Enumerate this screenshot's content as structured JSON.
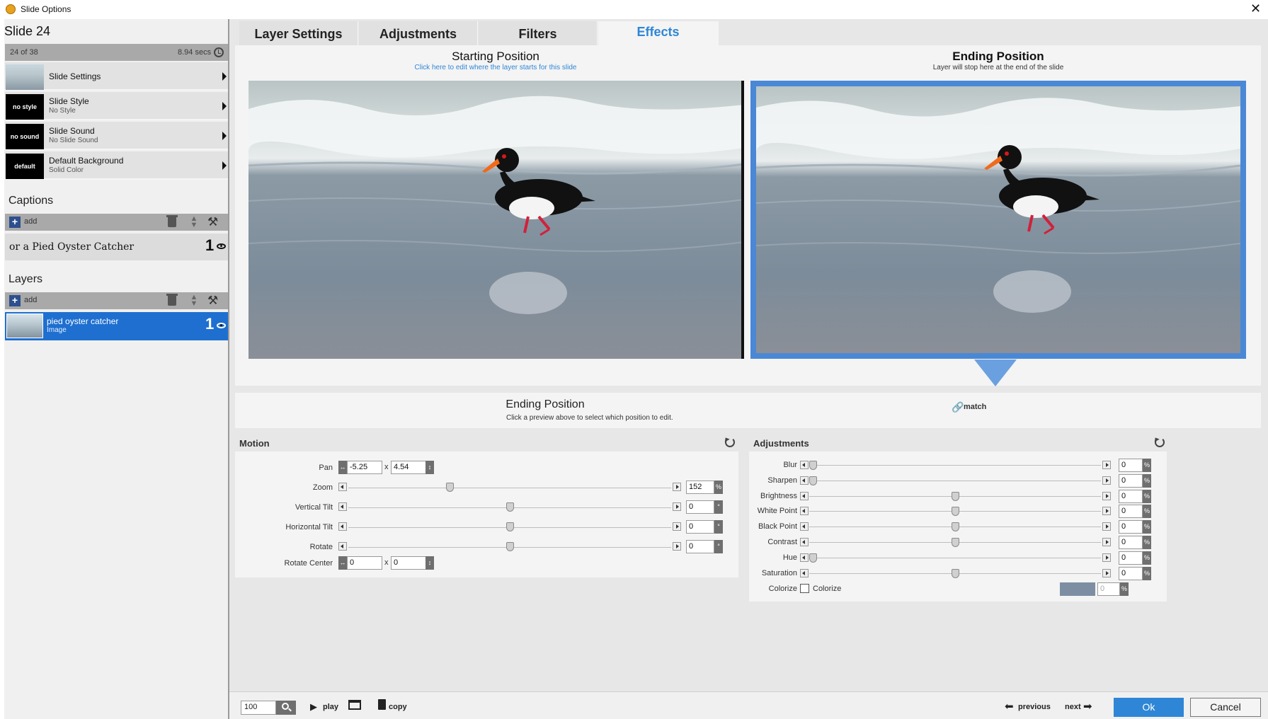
{
  "window": {
    "title": "Slide Options"
  },
  "slide": {
    "title": "Slide 24",
    "count": "24 of 38",
    "duration": "8.94 secs",
    "menu": [
      {
        "label": "Slide Settings",
        "sub": "",
        "thumb": ""
      },
      {
        "label": "Slide Style",
        "sub": "No Style",
        "thumb": "no style"
      },
      {
        "label": "Slide Sound",
        "sub": "No Slide Sound",
        "thumb": "no sound"
      },
      {
        "label": "Default Background",
        "sub": "Solid Color",
        "thumb": "default"
      }
    ]
  },
  "captions": {
    "heading": "Captions",
    "add_label": "add",
    "items": [
      {
        "text": "or a Pied Oyster Catcher",
        "number": "1"
      }
    ]
  },
  "layers": {
    "heading": "Layers",
    "add_label": "add",
    "items": [
      {
        "name": "pied oyster catcher",
        "type": "Image",
        "number": "1"
      }
    ]
  },
  "tabs": [
    {
      "label": "Layer Settings",
      "active": false
    },
    {
      "label": "Adjustments",
      "active": false
    },
    {
      "label": "Filters",
      "active": false
    },
    {
      "label": "Effects",
      "active": true
    }
  ],
  "preview": {
    "start_title": "Starting Position",
    "start_sub": "Click here to edit where the layer starts for this slide",
    "end_title": "Ending Position",
    "end_sub": "Layer will stop here at the end of the slide"
  },
  "editing": {
    "title": "Ending Position",
    "sub": "Click a preview above to select which position to edit.",
    "match_label": "match"
  },
  "motion": {
    "heading": "Motion",
    "pan": {
      "label": "Pan",
      "x": "-5.25",
      "y": "4.54",
      "sep": "x"
    },
    "zoom": {
      "label": "Zoom",
      "value": "152",
      "unit": "%",
      "level": 0.31
    },
    "vertical_tilt": {
      "label": "Vertical Tilt",
      "value": "0",
      "unit": "°",
      "level": 0.5
    },
    "horizontal_tilt": {
      "label": "Horizontal Tilt",
      "value": "0",
      "unit": "°",
      "level": 0.5
    },
    "rotate": {
      "label": "Rotate",
      "value": "0",
      "unit": "°",
      "level": 0.5
    },
    "rotate_center": {
      "label": "Rotate Center",
      "x": "0",
      "y": "0",
      "sep": "x"
    }
  },
  "adjustments": {
    "heading": "Adjustments",
    "rows": [
      {
        "label": "Blur",
        "value": "0",
        "unit": "%",
        "level": 0.0
      },
      {
        "label": "Sharpen",
        "value": "0",
        "unit": "%",
        "level": 0.0
      },
      {
        "label": "Brightness",
        "value": "0",
        "unit": "%",
        "level": 0.5
      },
      {
        "label": "White Point",
        "value": "0",
        "unit": "%",
        "level": 0.5
      },
      {
        "label": "Black Point",
        "value": "0",
        "unit": "%",
        "level": 0.5
      },
      {
        "label": "Contrast",
        "value": "0",
        "unit": "%",
        "level": 0.5
      },
      {
        "label": "Hue",
        "value": "0",
        "unit": "%",
        "level": 0.0
      },
      {
        "label": "Saturation",
        "value": "0",
        "unit": "%",
        "level": 0.5
      }
    ],
    "colorize": {
      "label": "Colorize",
      "checkbox_label": "Colorize",
      "value": "0",
      "unit": "%",
      "swatch_color": "#7d8ea3"
    }
  },
  "bottom": {
    "zoom_value": "100",
    "play_label": "play",
    "copy_label": "copy",
    "previous_label": "previous",
    "next_label": "next",
    "ok_label": "Ok",
    "cancel_label": "Cancel"
  },
  "colors": {
    "accent": "#2f86d6",
    "selection": "#1e6fd0",
    "tab_active_text": "#2f86d6"
  }
}
